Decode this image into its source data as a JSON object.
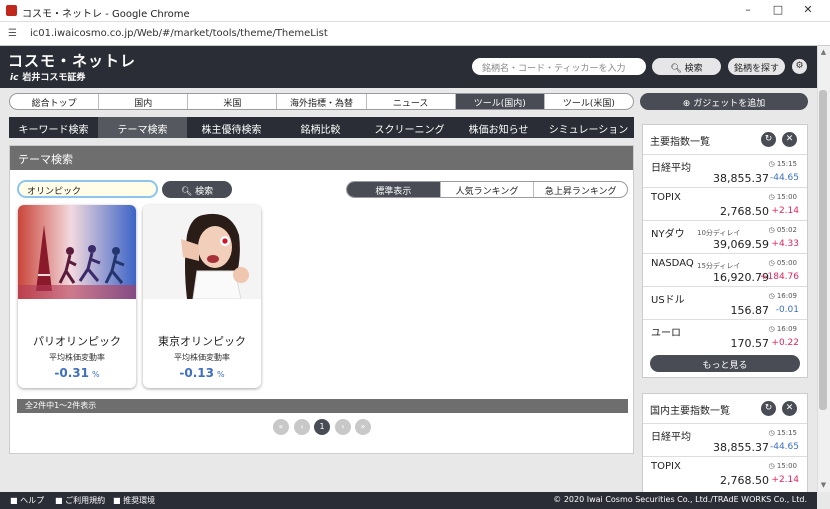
{
  "window": {
    "title": "コスモ・ネットレ - Google Chrome",
    "url": "ic01.iwaicosmo.co.jp/Web/#/market/tools/theme/ThemeList"
  },
  "header": {
    "logo_main": "コスモ・ネットレ",
    "logo_sub": "岩井コスモ証券",
    "logo_mark": "ic",
    "search_placeholder": "銘柄名・コード・ティッカーを入力",
    "search_button": "検索",
    "find_button": "銘柄を探す"
  },
  "main_tabs": [
    {
      "label": "総合トップ"
    },
    {
      "label": "国内"
    },
    {
      "label": "米国"
    },
    {
      "label": "海外指標・為替"
    },
    {
      "label": "ニュース"
    },
    {
      "label": "ツール(国内)",
      "active": true
    },
    {
      "label": "ツール(米国)"
    }
  ],
  "gadget_button": "ガジェットを追加",
  "sub_tabs": [
    {
      "label": "キーワード検索"
    },
    {
      "label": "テーマ検索",
      "active": true
    },
    {
      "label": "株主優待検索"
    },
    {
      "label": "銘柄比較"
    },
    {
      "label": "スクリーニング"
    },
    {
      "label": "株価お知らせ"
    },
    {
      "label": "シミュレーション"
    }
  ],
  "theme_search": {
    "title": "テーマ検索",
    "query": "オリンピック",
    "search_button": "検索",
    "views": [
      {
        "label": "標準表示",
        "active": true
      },
      {
        "label": "人気ランキング"
      },
      {
        "label": "急上昇ランキング"
      }
    ],
    "cards": [
      {
        "name": "パリオリンピック",
        "metric_label": "平均株価変動率",
        "value": "-0.31",
        "unit": "%"
      },
      {
        "name": "東京オリンピック",
        "metric_label": "平均株価変動率",
        "value": "-0.13",
        "unit": "%"
      }
    ],
    "count_text": "全2件中1～2件表示",
    "pager": {
      "first": "«",
      "prev": "‹",
      "current": "1",
      "next": "›",
      "last": "»"
    }
  },
  "indices_panel": {
    "title": "主要指数一覧",
    "rows": [
      {
        "name": "日経平均",
        "delay": "",
        "time": "15:15",
        "value": "38,855.37",
        "change": "-44.65",
        "dir": "down"
      },
      {
        "name": "TOPIX",
        "delay": "",
        "time": "15:00",
        "value": "2,768.50",
        "change": "+2.14",
        "dir": "up"
      },
      {
        "name": "NYダウ",
        "delay": "10分ディレイ",
        "time": "05:02",
        "value": "39,069.59",
        "change": "+4.33",
        "dir": "up"
      },
      {
        "name": "NASDAQ",
        "delay": "15分ディレイ",
        "time": "05:00",
        "value": "16,920.79",
        "change": "+184.76",
        "dir": "up"
      },
      {
        "name": "USドル",
        "delay": "",
        "time": "16:09",
        "value": "156.87",
        "change": "-0.01",
        "dir": "down"
      },
      {
        "name": "ユーロ",
        "delay": "",
        "time": "16:09",
        "value": "170.57",
        "change": "+0.22",
        "dir": "up"
      }
    ],
    "more_button": "もっと見る"
  },
  "domestic_panel": {
    "title": "国内主要指数一覧",
    "rows": [
      {
        "name": "日経平均",
        "time": "15:15",
        "value": "38,855.37",
        "change": "-44.65",
        "dir": "down"
      },
      {
        "name": "TOPIX",
        "time": "15:00",
        "value": "2,768.50",
        "change": "+2.14",
        "dir": "up"
      }
    ]
  },
  "footer": {
    "help": "ヘルプ",
    "terms": "ご利用規約",
    "env": "推奨環境",
    "copyright": "© 2020 Iwai Cosmo Securities Co., Ltd./TRAdE WORKS Co., Ltd."
  },
  "colors": {
    "up": "#e0245e",
    "down": "#3f6fbf",
    "accent": "#4a4c55",
    "header": "#2b2d36"
  }
}
